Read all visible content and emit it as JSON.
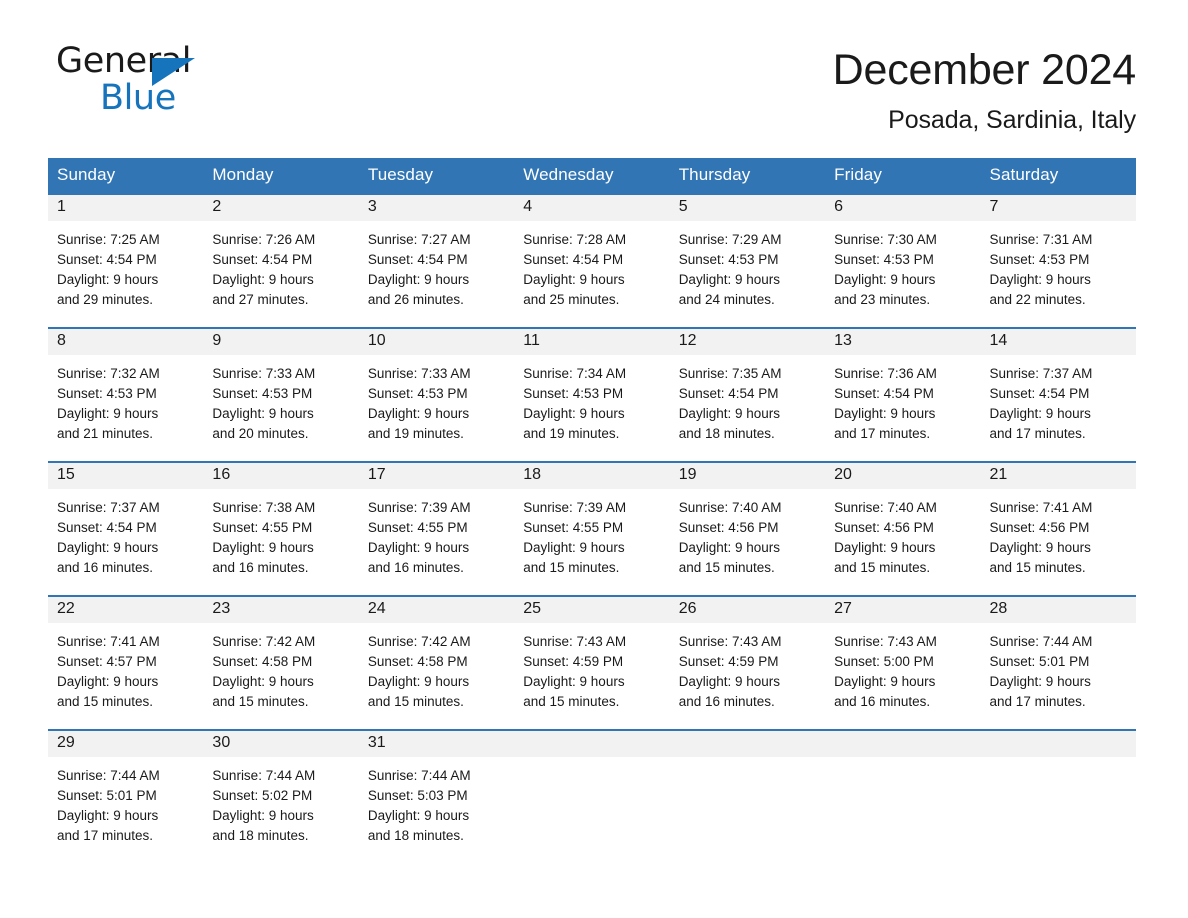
{
  "logo": {
    "word1": "General",
    "word2": "Blue",
    "triangle_color": "#1574bc"
  },
  "header": {
    "title": "December 2024",
    "subtitle": "Posada, Sardinia, Italy"
  },
  "theme": {
    "header_blue": "#3275b4",
    "daynum_band": "#f2f2f2",
    "text": "#1a1a1a"
  },
  "calendar": {
    "weekday_headers": [
      "Sunday",
      "Monday",
      "Tuesday",
      "Wednesday",
      "Thursday",
      "Friday",
      "Saturday"
    ],
    "weeks": [
      [
        {
          "day": "1",
          "sunrise": "Sunrise: 7:25 AM",
          "sunset": "Sunset: 4:54 PM",
          "daylight_line1": "Daylight: 9 hours",
          "daylight_line2": "and 29 minutes."
        },
        {
          "day": "2",
          "sunrise": "Sunrise: 7:26 AM",
          "sunset": "Sunset: 4:54 PM",
          "daylight_line1": "Daylight: 9 hours",
          "daylight_line2": "and 27 minutes."
        },
        {
          "day": "3",
          "sunrise": "Sunrise: 7:27 AM",
          "sunset": "Sunset: 4:54 PM",
          "daylight_line1": "Daylight: 9 hours",
          "daylight_line2": "and 26 minutes."
        },
        {
          "day": "4",
          "sunrise": "Sunrise: 7:28 AM",
          "sunset": "Sunset: 4:54 PM",
          "daylight_line1": "Daylight: 9 hours",
          "daylight_line2": "and 25 minutes."
        },
        {
          "day": "5",
          "sunrise": "Sunrise: 7:29 AM",
          "sunset": "Sunset: 4:53 PM",
          "daylight_line1": "Daylight: 9 hours",
          "daylight_line2": "and 24 minutes."
        },
        {
          "day": "6",
          "sunrise": "Sunrise: 7:30 AM",
          "sunset": "Sunset: 4:53 PM",
          "daylight_line1": "Daylight: 9 hours",
          "daylight_line2": "and 23 minutes."
        },
        {
          "day": "7",
          "sunrise": "Sunrise: 7:31 AM",
          "sunset": "Sunset: 4:53 PM",
          "daylight_line1": "Daylight: 9 hours",
          "daylight_line2": "and 22 minutes."
        }
      ],
      [
        {
          "day": "8",
          "sunrise": "Sunrise: 7:32 AM",
          "sunset": "Sunset: 4:53 PM",
          "daylight_line1": "Daylight: 9 hours",
          "daylight_line2": "and 21 minutes."
        },
        {
          "day": "9",
          "sunrise": "Sunrise: 7:33 AM",
          "sunset": "Sunset: 4:53 PM",
          "daylight_line1": "Daylight: 9 hours",
          "daylight_line2": "and 20 minutes."
        },
        {
          "day": "10",
          "sunrise": "Sunrise: 7:33 AM",
          "sunset": "Sunset: 4:53 PM",
          "daylight_line1": "Daylight: 9 hours",
          "daylight_line2": "and 19 minutes."
        },
        {
          "day": "11",
          "sunrise": "Sunrise: 7:34 AM",
          "sunset": "Sunset: 4:53 PM",
          "daylight_line1": "Daylight: 9 hours",
          "daylight_line2": "and 19 minutes."
        },
        {
          "day": "12",
          "sunrise": "Sunrise: 7:35 AM",
          "sunset": "Sunset: 4:54 PM",
          "daylight_line1": "Daylight: 9 hours",
          "daylight_line2": "and 18 minutes."
        },
        {
          "day": "13",
          "sunrise": "Sunrise: 7:36 AM",
          "sunset": "Sunset: 4:54 PM",
          "daylight_line1": "Daylight: 9 hours",
          "daylight_line2": "and 17 minutes."
        },
        {
          "day": "14",
          "sunrise": "Sunrise: 7:37 AM",
          "sunset": "Sunset: 4:54 PM",
          "daylight_line1": "Daylight: 9 hours",
          "daylight_line2": "and 17 minutes."
        }
      ],
      [
        {
          "day": "15",
          "sunrise": "Sunrise: 7:37 AM",
          "sunset": "Sunset: 4:54 PM",
          "daylight_line1": "Daylight: 9 hours",
          "daylight_line2": "and 16 minutes."
        },
        {
          "day": "16",
          "sunrise": "Sunrise: 7:38 AM",
          "sunset": "Sunset: 4:55 PM",
          "daylight_line1": "Daylight: 9 hours",
          "daylight_line2": "and 16 minutes."
        },
        {
          "day": "17",
          "sunrise": "Sunrise: 7:39 AM",
          "sunset": "Sunset: 4:55 PM",
          "daylight_line1": "Daylight: 9 hours",
          "daylight_line2": "and 16 minutes."
        },
        {
          "day": "18",
          "sunrise": "Sunrise: 7:39 AM",
          "sunset": "Sunset: 4:55 PM",
          "daylight_line1": "Daylight: 9 hours",
          "daylight_line2": "and 15 minutes."
        },
        {
          "day": "19",
          "sunrise": "Sunrise: 7:40 AM",
          "sunset": "Sunset: 4:56 PM",
          "daylight_line1": "Daylight: 9 hours",
          "daylight_line2": "and 15 minutes."
        },
        {
          "day": "20",
          "sunrise": "Sunrise: 7:40 AM",
          "sunset": "Sunset: 4:56 PM",
          "daylight_line1": "Daylight: 9 hours",
          "daylight_line2": "and 15 minutes."
        },
        {
          "day": "21",
          "sunrise": "Sunrise: 7:41 AM",
          "sunset": "Sunset: 4:56 PM",
          "daylight_line1": "Daylight: 9 hours",
          "daylight_line2": "and 15 minutes."
        }
      ],
      [
        {
          "day": "22",
          "sunrise": "Sunrise: 7:41 AM",
          "sunset": "Sunset: 4:57 PM",
          "daylight_line1": "Daylight: 9 hours",
          "daylight_line2": "and 15 minutes."
        },
        {
          "day": "23",
          "sunrise": "Sunrise: 7:42 AM",
          "sunset": "Sunset: 4:58 PM",
          "daylight_line1": "Daylight: 9 hours",
          "daylight_line2": "and 15 minutes."
        },
        {
          "day": "24",
          "sunrise": "Sunrise: 7:42 AM",
          "sunset": "Sunset: 4:58 PM",
          "daylight_line1": "Daylight: 9 hours",
          "daylight_line2": "and 15 minutes."
        },
        {
          "day": "25",
          "sunrise": "Sunrise: 7:43 AM",
          "sunset": "Sunset: 4:59 PM",
          "daylight_line1": "Daylight: 9 hours",
          "daylight_line2": "and 15 minutes."
        },
        {
          "day": "26",
          "sunrise": "Sunrise: 7:43 AM",
          "sunset": "Sunset: 4:59 PM",
          "daylight_line1": "Daylight: 9 hours",
          "daylight_line2": "and 16 minutes."
        },
        {
          "day": "27",
          "sunrise": "Sunrise: 7:43 AM",
          "sunset": "Sunset: 5:00 PM",
          "daylight_line1": "Daylight: 9 hours",
          "daylight_line2": "and 16 minutes."
        },
        {
          "day": "28",
          "sunrise": "Sunrise: 7:44 AM",
          "sunset": "Sunset: 5:01 PM",
          "daylight_line1": "Daylight: 9 hours",
          "daylight_line2": "and 17 minutes."
        }
      ],
      [
        {
          "day": "29",
          "sunrise": "Sunrise: 7:44 AM",
          "sunset": "Sunset: 5:01 PM",
          "daylight_line1": "Daylight: 9 hours",
          "daylight_line2": "and 17 minutes."
        },
        {
          "day": "30",
          "sunrise": "Sunrise: 7:44 AM",
          "sunset": "Sunset: 5:02 PM",
          "daylight_line1": "Daylight: 9 hours",
          "daylight_line2": "and 18 minutes."
        },
        {
          "day": "31",
          "sunrise": "Sunrise: 7:44 AM",
          "sunset": "Sunset: 5:03 PM",
          "daylight_line1": "Daylight: 9 hours",
          "daylight_line2": "and 18 minutes."
        },
        {
          "day": "",
          "sunrise": "",
          "sunset": "",
          "daylight_line1": "",
          "daylight_line2": ""
        },
        {
          "day": "",
          "sunrise": "",
          "sunset": "",
          "daylight_line1": "",
          "daylight_line2": ""
        },
        {
          "day": "",
          "sunrise": "",
          "sunset": "",
          "daylight_line1": "",
          "daylight_line2": ""
        },
        {
          "day": "",
          "sunrise": "",
          "sunset": "",
          "daylight_line1": "",
          "daylight_line2": ""
        }
      ]
    ]
  }
}
